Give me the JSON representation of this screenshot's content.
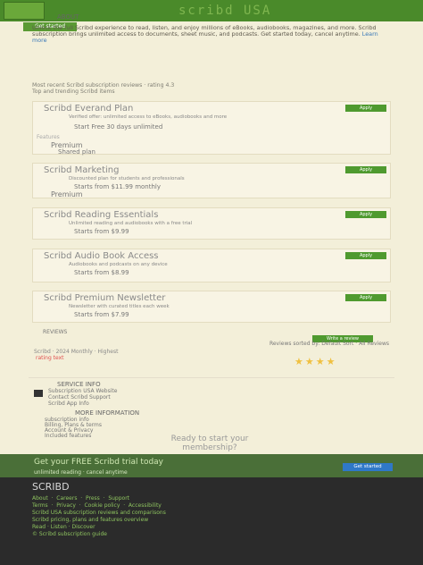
{
  "header": {
    "title": "scribd USA"
  },
  "about": {
    "heading": "ABOUT",
    "text": "Unlock the full Scribd experience to read, listen, and enjoy millions of eBooks, audiobooks, magazines, and more. Scribd subscription brings unlimited access to documents, sheet music, and podcasts. Get started today, cancel anytime.",
    "link": "Learn more"
  },
  "breadcrumb": {
    "line1": "Most recent Scribd subscription reviews · rating 4.3",
    "line2": "Top and trending Scribd items"
  },
  "cards": [
    {
      "title": "Scribd Everand Plan",
      "button": "Apply",
      "meta": "Verified offer: unlimited access to eBooks, audiobooks and more",
      "detail": "Start Free  30 days  unlimited",
      "sub1": "Features",
      "sub2": "Premium",
      "sub3": "Shared plan"
    },
    {
      "title": "Scribd Marketing",
      "button": "Apply",
      "meta": "Discounted plan for students and professionals",
      "detail": "Starts from  $11.99  monthly",
      "sub1": "Features",
      "sub2": "Premium",
      "sub3": "Nothing to pay"
    },
    {
      "title": "Scribd Reading Essentials",
      "button": "Apply",
      "meta": "Unlimited reading and audiobooks with a free trial",
      "detail": "Starts from  $9.99",
      "sub1": "Features",
      "sub2": "Premium",
      "sub3": "Nothing to pay"
    },
    {
      "title": "Scribd Audio Book Access",
      "button": "Apply",
      "meta": "Audiobooks and podcasts on any device",
      "detail": "Starts from  $8.99",
      "sub1": "Features",
      "sub2": "Premium",
      "sub3": "Nothing to pay"
    },
    {
      "title": "Scribd Premium Newsletter",
      "button": "Apply",
      "meta": "Newsletter with curated titles each week",
      "detail": "Starts from  $7.99",
      "sub1": "Features",
      "sub2": "Premium",
      "sub3": "Nothing to pay"
    }
  ],
  "reviews": {
    "heading": "REVIEWS",
    "write_button": "Write a review",
    "sort_text": "Reviews sorted by: Default Sort · All Reviews",
    "row": "Scribd · 2024 Monthly · Highest",
    "rating_text": "rating text",
    "stars": "★★★★"
  },
  "info": {
    "heading": "SERVICE INFO",
    "lines": [
      "Subscription USA Website",
      "Contact Scribd Support",
      "Scribd App Info"
    ]
  },
  "more": {
    "heading": "MORE INFORMATION",
    "lines": [
      "subscription info",
      "Billing, Plans & terms",
      "Account & Privacy",
      "Included features"
    ]
  },
  "cta": {
    "line1": "Ready to start your",
    "line2": "membership?"
  },
  "strip": {
    "text": "Get your FREE Scribd trial today",
    "sub": "unlimited reading · cancel anytime",
    "pill": "Get started"
  },
  "footer": {
    "head": "SCRIBD",
    "lines": "About  ·  Careers  ·  Press  ·  Support\nTerms  ·  Privacy  ·  Cookie policy  ·  Accessibility\nScribd USA subscription reviews and comparisons\nScribd pricing, plans and features overview\nRead · Listen · Discover\n© Scribd subscription guide"
  }
}
